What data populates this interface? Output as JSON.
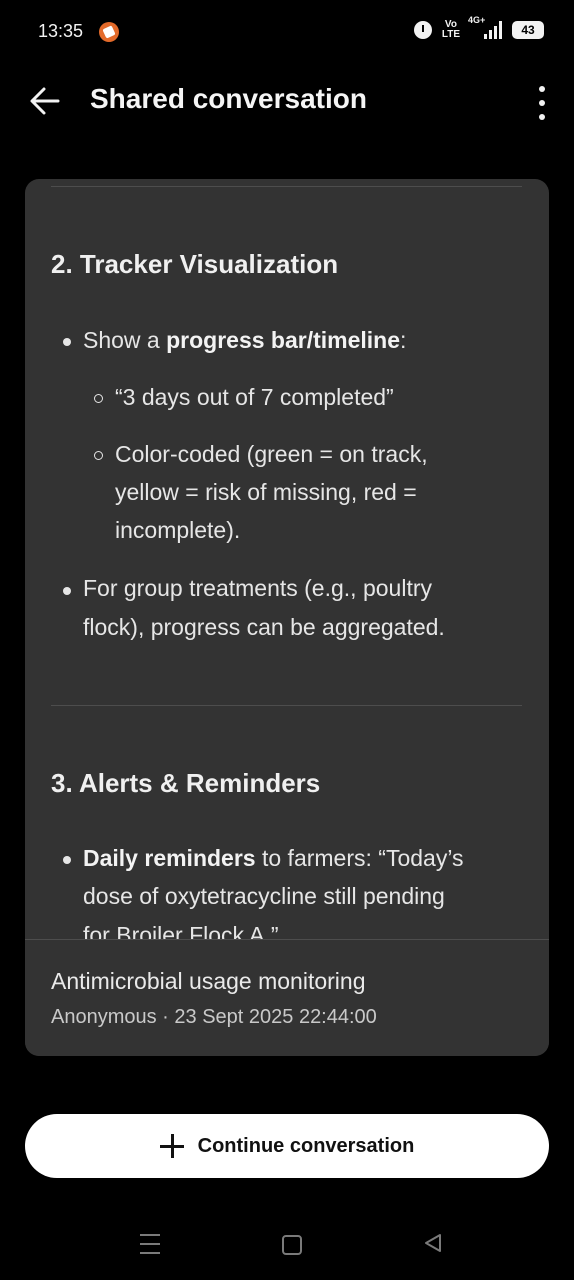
{
  "status_bar": {
    "time": "13:35",
    "volte_top": "Vo",
    "volte_bottom": "LTE",
    "network": "4G+",
    "battery": "43"
  },
  "app_bar": {
    "title": "Shared conversation"
  },
  "content": {
    "section2_heading": "2. Tracker Visualization",
    "s2_b1_pre": "Show a ",
    "s2_b1_bold": "progress bar/timeline",
    "s2_b1_post": ":",
    "s2_sub1": "“3 days out of 7 completed”",
    "s2_sub2_l1": "Color-coded (green = on track,",
    "s2_sub2_l2": "yellow = risk of missing, red =",
    "s2_sub2_l3": "incomplete).",
    "s2_b2_l1": "For group treatments (e.g., poultry",
    "s2_b2_l2": "flock), progress can be aggregated.",
    "section3_heading": "3. Alerts & Reminders",
    "s3_b1_bold": "Daily reminders",
    "s3_b1_post": " to farmers: “Today’s",
    "s3_b1_l2": "dose of oxytetracycline still pending",
    "s3_b1_l3": "for Broiler Flock A.”"
  },
  "conversation": {
    "title": "Antimicrobial usage monitoring",
    "meta": "Anonymous · 23 Sept 2025 22:44:00"
  },
  "actions": {
    "continue_label": "Continue conversation"
  }
}
